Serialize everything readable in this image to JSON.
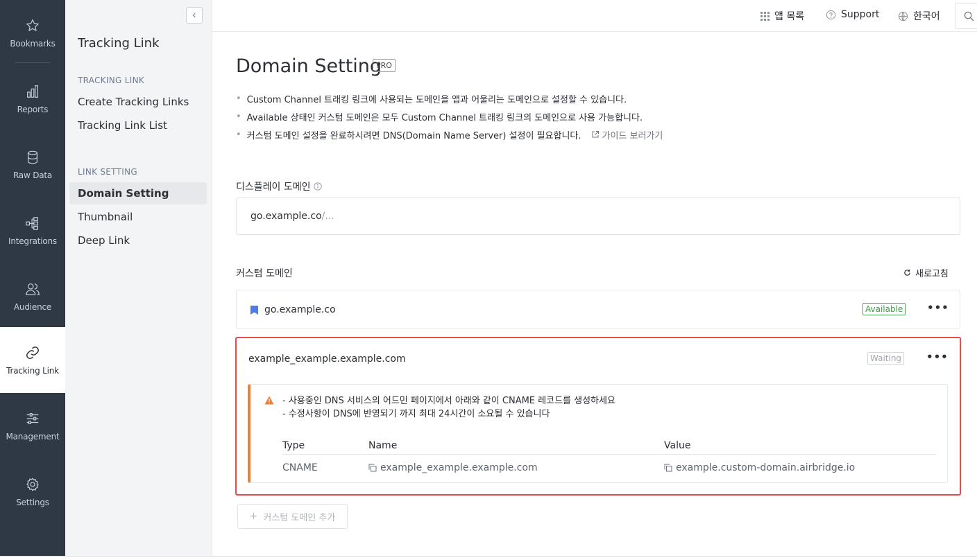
{
  "rail": {
    "items": [
      {
        "label": "Bookmarks",
        "icon": "star-icon"
      },
      {
        "label": "Reports",
        "icon": "bar-chart-icon"
      },
      {
        "label": "Raw Data",
        "icon": "database-icon"
      },
      {
        "label": "Integrations",
        "icon": "integration-icon"
      },
      {
        "label": "Audience",
        "icon": "users-icon"
      },
      {
        "label": "Tracking Link",
        "icon": "link-icon"
      },
      {
        "label": "Management",
        "icon": "sliders-icon"
      },
      {
        "label": "Settings",
        "icon": "gear-icon"
      }
    ],
    "active": "Tracking Link"
  },
  "subnav": {
    "title": "Tracking Link",
    "group1": "TRACKING LINK",
    "create": "Create Tracking Links",
    "list": "Tracking Link List",
    "group2": "LINK SETTING",
    "domain": "Domain Setting",
    "thumbnail": "Thumbnail",
    "deeplink": "Deep Link"
  },
  "topbar": {
    "apps": "앱 목록",
    "support": "Support",
    "language": "한국어"
  },
  "main": {
    "title": "Domain Setting",
    "badge": "PRO",
    "bullets": [
      "Custom Channel 트래킹 링크에 사용되는 도메인을 앱과 어울리는 도메인으로 설정할 수 있습니다.",
      "Available 상태인 커스텀 도메인은 모두 Custom Channel 트래킹 링크의 도메인으로 사용 가능합니다.",
      "커스텀 도메인 설정을 완료하시려면 DNS(Domain Name Server) 설정이 필요합니다."
    ],
    "guide": "가이드 보러가기",
    "display_label": "디스플레이 도메인",
    "display_value": "go.example.co",
    "display_suffix": "/...",
    "custom_label": "커스텀 도메인",
    "refresh": "새로고침",
    "domains": [
      {
        "name": "go.example.co",
        "status": "Available"
      },
      {
        "name": "example_example.example.com",
        "status": "Waiting"
      }
    ],
    "notice": {
      "line1": "- 사용중인 DNS 서비스의 어드민 페이지에서 아래와 같이 CNAME 레코드를 생성하세요",
      "line2": "- 수정사항이 DNS에 반영되기 까지 최대 24시간이 소요될 수 있습니다",
      "headers": [
        "Type",
        "Name",
        "Value"
      ],
      "row": [
        "CNAME",
        "example_example.example.com",
        "example.custom-domain.airbridge.io"
      ]
    },
    "add_button": "커스텀 도메인 추가"
  },
  "colors": {
    "rail_bg": "#2f3845",
    "available": "#3b9a4c",
    "highlight": "#e24d4d",
    "notice_accent": "#ef7d3b",
    "bookmark": "#4b7bec"
  }
}
